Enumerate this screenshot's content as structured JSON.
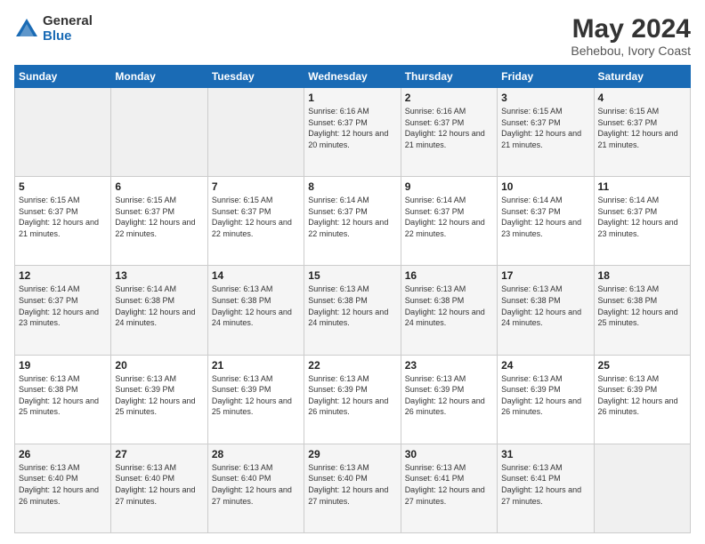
{
  "logo": {
    "general": "General",
    "blue": "Blue"
  },
  "title": "May 2024",
  "location": "Behebou, Ivory Coast",
  "days_of_week": [
    "Sunday",
    "Monday",
    "Tuesday",
    "Wednesday",
    "Thursday",
    "Friday",
    "Saturday"
  ],
  "weeks": [
    [
      {
        "day": "",
        "sunrise": "",
        "sunset": "",
        "daylight": ""
      },
      {
        "day": "",
        "sunrise": "",
        "sunset": "",
        "daylight": ""
      },
      {
        "day": "",
        "sunrise": "",
        "sunset": "",
        "daylight": ""
      },
      {
        "day": "1",
        "sunrise": "Sunrise: 6:16 AM",
        "sunset": "Sunset: 6:37 PM",
        "daylight": "Daylight: 12 hours and 20 minutes."
      },
      {
        "day": "2",
        "sunrise": "Sunrise: 6:16 AM",
        "sunset": "Sunset: 6:37 PM",
        "daylight": "Daylight: 12 hours and 21 minutes."
      },
      {
        "day": "3",
        "sunrise": "Sunrise: 6:15 AM",
        "sunset": "Sunset: 6:37 PM",
        "daylight": "Daylight: 12 hours and 21 minutes."
      },
      {
        "day": "4",
        "sunrise": "Sunrise: 6:15 AM",
        "sunset": "Sunset: 6:37 PM",
        "daylight": "Daylight: 12 hours and 21 minutes."
      }
    ],
    [
      {
        "day": "5",
        "sunrise": "Sunrise: 6:15 AM",
        "sunset": "Sunset: 6:37 PM",
        "daylight": "Daylight: 12 hours and 21 minutes."
      },
      {
        "day": "6",
        "sunrise": "Sunrise: 6:15 AM",
        "sunset": "Sunset: 6:37 PM",
        "daylight": "Daylight: 12 hours and 22 minutes."
      },
      {
        "day": "7",
        "sunrise": "Sunrise: 6:15 AM",
        "sunset": "Sunset: 6:37 PM",
        "daylight": "Daylight: 12 hours and 22 minutes."
      },
      {
        "day": "8",
        "sunrise": "Sunrise: 6:14 AM",
        "sunset": "Sunset: 6:37 PM",
        "daylight": "Daylight: 12 hours and 22 minutes."
      },
      {
        "day": "9",
        "sunrise": "Sunrise: 6:14 AM",
        "sunset": "Sunset: 6:37 PM",
        "daylight": "Daylight: 12 hours and 22 minutes."
      },
      {
        "day": "10",
        "sunrise": "Sunrise: 6:14 AM",
        "sunset": "Sunset: 6:37 PM",
        "daylight": "Daylight: 12 hours and 23 minutes."
      },
      {
        "day": "11",
        "sunrise": "Sunrise: 6:14 AM",
        "sunset": "Sunset: 6:37 PM",
        "daylight": "Daylight: 12 hours and 23 minutes."
      }
    ],
    [
      {
        "day": "12",
        "sunrise": "Sunrise: 6:14 AM",
        "sunset": "Sunset: 6:37 PM",
        "daylight": "Daylight: 12 hours and 23 minutes."
      },
      {
        "day": "13",
        "sunrise": "Sunrise: 6:14 AM",
        "sunset": "Sunset: 6:38 PM",
        "daylight": "Daylight: 12 hours and 24 minutes."
      },
      {
        "day": "14",
        "sunrise": "Sunrise: 6:13 AM",
        "sunset": "Sunset: 6:38 PM",
        "daylight": "Daylight: 12 hours and 24 minutes."
      },
      {
        "day": "15",
        "sunrise": "Sunrise: 6:13 AM",
        "sunset": "Sunset: 6:38 PM",
        "daylight": "Daylight: 12 hours and 24 minutes."
      },
      {
        "day": "16",
        "sunrise": "Sunrise: 6:13 AM",
        "sunset": "Sunset: 6:38 PM",
        "daylight": "Daylight: 12 hours and 24 minutes."
      },
      {
        "day": "17",
        "sunrise": "Sunrise: 6:13 AM",
        "sunset": "Sunset: 6:38 PM",
        "daylight": "Daylight: 12 hours and 24 minutes."
      },
      {
        "day": "18",
        "sunrise": "Sunrise: 6:13 AM",
        "sunset": "Sunset: 6:38 PM",
        "daylight": "Daylight: 12 hours and 25 minutes."
      }
    ],
    [
      {
        "day": "19",
        "sunrise": "Sunrise: 6:13 AM",
        "sunset": "Sunset: 6:38 PM",
        "daylight": "Daylight: 12 hours and 25 minutes."
      },
      {
        "day": "20",
        "sunrise": "Sunrise: 6:13 AM",
        "sunset": "Sunset: 6:39 PM",
        "daylight": "Daylight: 12 hours and 25 minutes."
      },
      {
        "day": "21",
        "sunrise": "Sunrise: 6:13 AM",
        "sunset": "Sunset: 6:39 PM",
        "daylight": "Daylight: 12 hours and 25 minutes."
      },
      {
        "day": "22",
        "sunrise": "Sunrise: 6:13 AM",
        "sunset": "Sunset: 6:39 PM",
        "daylight": "Daylight: 12 hours and 26 minutes."
      },
      {
        "day": "23",
        "sunrise": "Sunrise: 6:13 AM",
        "sunset": "Sunset: 6:39 PM",
        "daylight": "Daylight: 12 hours and 26 minutes."
      },
      {
        "day": "24",
        "sunrise": "Sunrise: 6:13 AM",
        "sunset": "Sunset: 6:39 PM",
        "daylight": "Daylight: 12 hours and 26 minutes."
      },
      {
        "day": "25",
        "sunrise": "Sunrise: 6:13 AM",
        "sunset": "Sunset: 6:39 PM",
        "daylight": "Daylight: 12 hours and 26 minutes."
      }
    ],
    [
      {
        "day": "26",
        "sunrise": "Sunrise: 6:13 AM",
        "sunset": "Sunset: 6:40 PM",
        "daylight": "Daylight: 12 hours and 26 minutes."
      },
      {
        "day": "27",
        "sunrise": "Sunrise: 6:13 AM",
        "sunset": "Sunset: 6:40 PM",
        "daylight": "Daylight: 12 hours and 27 minutes."
      },
      {
        "day": "28",
        "sunrise": "Sunrise: 6:13 AM",
        "sunset": "Sunset: 6:40 PM",
        "daylight": "Daylight: 12 hours and 27 minutes."
      },
      {
        "day": "29",
        "sunrise": "Sunrise: 6:13 AM",
        "sunset": "Sunset: 6:40 PM",
        "daylight": "Daylight: 12 hours and 27 minutes."
      },
      {
        "day": "30",
        "sunrise": "Sunrise: 6:13 AM",
        "sunset": "Sunset: 6:41 PM",
        "daylight": "Daylight: 12 hours and 27 minutes."
      },
      {
        "day": "31",
        "sunrise": "Sunrise: 6:13 AM",
        "sunset": "Sunset: 6:41 PM",
        "daylight": "Daylight: 12 hours and 27 minutes."
      },
      {
        "day": "",
        "sunrise": "",
        "sunset": "",
        "daylight": ""
      }
    ]
  ]
}
